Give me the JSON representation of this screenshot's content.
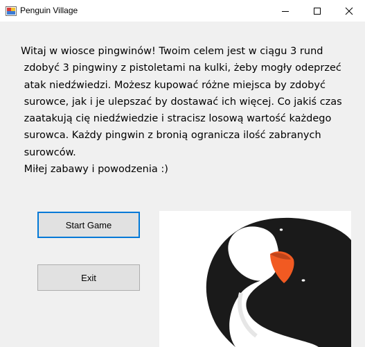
{
  "window": {
    "title": "Penguin Village",
    "icon": "app-window-icon",
    "controls": [
      "minimize-icon",
      "maximize-icon",
      "close-icon"
    ]
  },
  "welcome_text": "Witaj w wiosce pingwinów! Twoim celem jest w ciągu 3 rund\n zdobyć 3 pingwiny z pistoletami na kulki, żeby mogły odeprzeć\n atak niedźwiedzi. Możesz kupować różne miejsca by zdobyć\n surowce, jak i je ulepszać by dostawać ich więcej. Co jakiś czas\n zaatakują cię niedźwiedzie i stracisz losową wartość każdego\n surowca. Każdy pingwin z bronią ogranicza ilość zabranych\n surowców.\n Miłej zabawy i powodzenia :)",
  "buttons": {
    "start": "Start Game",
    "exit": "Exit"
  },
  "picture": {
    "icon": "penguin-illustration"
  },
  "colors": {
    "background": "#f0f0f0",
    "titlebar": "#ffffff",
    "button_face": "#e1e1e1",
    "focus_border": "#0078d7",
    "penguin_body": "#1a1a1a",
    "penguin_beak": "#f15a22"
  }
}
